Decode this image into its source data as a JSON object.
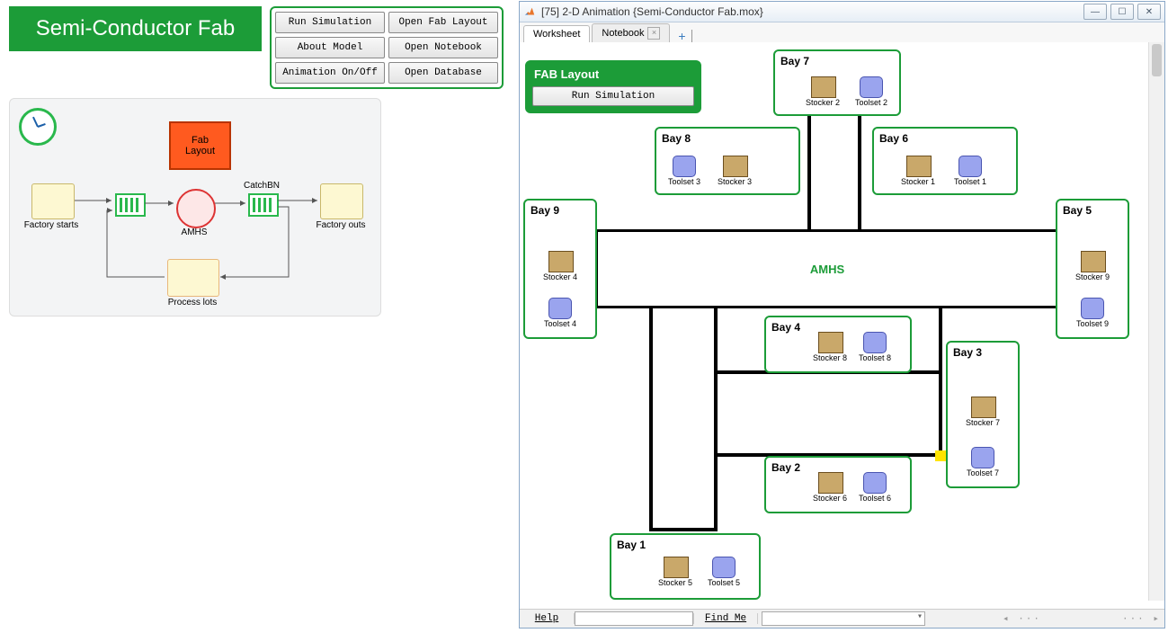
{
  "header": {
    "title": "Semi-Conductor Fab"
  },
  "buttons": {
    "run_sim": "Run Simulation",
    "open_fab": "Open Fab Layout",
    "about": "About Model",
    "open_nb": "Open Notebook",
    "anim": "Animation On/Off",
    "open_db": "Open Database"
  },
  "flow": {
    "fab_layout": "Fab\nLayout",
    "factory_starts": "Factory starts",
    "amhs": "AMHS",
    "catch_bn": "CatchBN",
    "factory_outs": "Factory outs",
    "process_lots": "Process lots"
  },
  "anim_window": {
    "title": "[75] 2-D Animation {Semi-Conductor Fab.mox}",
    "tab_worksheet": "Worksheet",
    "tab_notebook": "Notebook"
  },
  "fab_panel": {
    "title": "FAB Layout",
    "run": "Run Simulation"
  },
  "amhs_label": "AMHS",
  "bays": {
    "b1": "Bay 1",
    "b2": "Bay 2",
    "b3": "Bay 3",
    "b4": "Bay 4",
    "b5": "Bay 5",
    "b6": "Bay 6",
    "b7": "Bay 7",
    "b8": "Bay 8",
    "b9": "Bay 9"
  },
  "units": {
    "stocker1": "Stocker 1",
    "stocker2": "Stocker 2",
    "stocker3": "Stocker 3",
    "stocker4": "Stocker 4",
    "stocker5": "Stocker 5",
    "stocker6": "Stocker 6",
    "stocker7": "Stocker 7",
    "stocker8": "Stocker 8",
    "stocker9": "Stocker 9",
    "toolset1": "Toolset 1",
    "toolset2": "Toolset 2",
    "toolset3": "Toolset 3",
    "toolset4": "Toolset 4",
    "toolset5": "Toolset 5",
    "toolset6": "Toolset 6",
    "toolset7": "Toolset 7",
    "toolset8": "Toolset 8",
    "toolset9": "Toolset 9"
  },
  "status": {
    "help": "Help",
    "find": "Find Me"
  }
}
